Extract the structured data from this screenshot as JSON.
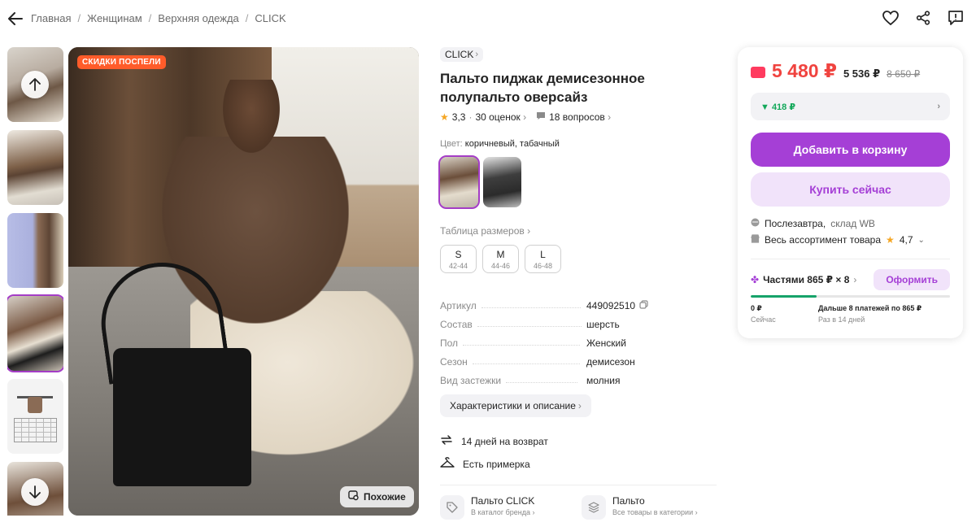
{
  "breadcrumb": [
    "Главная",
    "Женщинам",
    "Верхняя одежда",
    "CLICK"
  ],
  "breadcrumb_sep": "/",
  "promo_badge": "СКИДКИ ПОСПЕЛИ",
  "similar_button": "Похожие",
  "product": {
    "brand": "CLICK",
    "title": "Пальто пиджак демисезонное полупальто оверсайз",
    "rating": "3,3",
    "reviews": "30 оценок",
    "questions": "18 вопросов",
    "color_label": "Цвет:",
    "color_value": "коричневый, табачный",
    "size_table": "Таблица размеров",
    "sizes": [
      {
        "size": "S",
        "range": "42-44"
      },
      {
        "size": "M",
        "range": "44-46"
      },
      {
        "size": "L",
        "range": "46-48"
      }
    ],
    "specs": [
      {
        "key": "Артикул",
        "value": "449092510"
      },
      {
        "key": "Состав",
        "value": "шерсть"
      },
      {
        "key": "Пол",
        "value": "Женский"
      },
      {
        "key": "Сезон",
        "value": "демисезон"
      },
      {
        "key": "Вид застежки",
        "value": "молния"
      }
    ],
    "chars_button": "Характеристики и описание",
    "perks": [
      "14 дней на возврат",
      "Есть примерка"
    ],
    "category_links": [
      {
        "title": "Пальто CLICK",
        "subtitle": "В каталог бренда"
      },
      {
        "title": "Пальто",
        "subtitle": "Все товары в категории"
      }
    ]
  },
  "buy": {
    "price": "5 480 ₽",
    "price_secondary": "5 536 ₽",
    "price_old": "8 650 ₽",
    "cashback": "▼ 418 ₽",
    "add_to_cart": "Добавить в корзину",
    "buy_now": "Купить сейчас",
    "delivery_day": "Послезавтра,",
    "delivery_place": "склад WB",
    "assortment": "Весь ассортимент товара",
    "assortment_rating": "4,7",
    "installment": "Частями 865 ₽ × 8",
    "installment_button": "Оформить",
    "installment_progress": 0.33,
    "installment_now_amount": "0 ₽",
    "installment_now_label": "Сейчас",
    "installment_later_amount": "Дальше 8 платежей по 865 ₽",
    "installment_later_label": "Раз в 14 дней"
  },
  "colors": {
    "accent": "#a53fd6",
    "price_red": "#f0433f",
    "cashback_green": "#13a85a"
  }
}
